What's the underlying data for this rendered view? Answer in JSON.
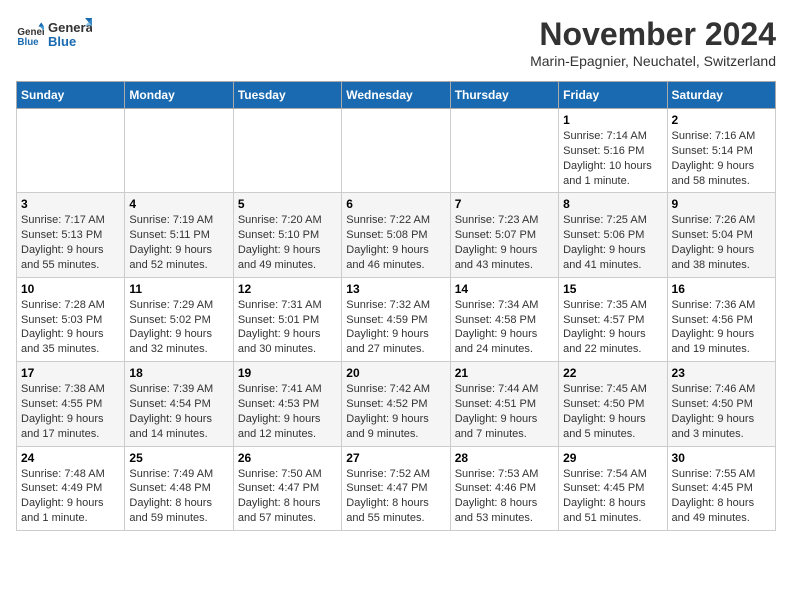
{
  "logo": {
    "line1": "General",
    "line2": "Blue"
  },
  "title": "November 2024",
  "location": "Marin-Epagnier, Neuchatel, Switzerland",
  "days_of_week": [
    "Sunday",
    "Monday",
    "Tuesday",
    "Wednesday",
    "Thursday",
    "Friday",
    "Saturday"
  ],
  "weeks": [
    [
      {
        "day": "",
        "info": ""
      },
      {
        "day": "",
        "info": ""
      },
      {
        "day": "",
        "info": ""
      },
      {
        "day": "",
        "info": ""
      },
      {
        "day": "",
        "info": ""
      },
      {
        "day": "1",
        "info": "Sunrise: 7:14 AM\nSunset: 5:16 PM\nDaylight: 10 hours and 1 minute."
      },
      {
        "day": "2",
        "info": "Sunrise: 7:16 AM\nSunset: 5:14 PM\nDaylight: 9 hours and 58 minutes."
      }
    ],
    [
      {
        "day": "3",
        "info": "Sunrise: 7:17 AM\nSunset: 5:13 PM\nDaylight: 9 hours and 55 minutes."
      },
      {
        "day": "4",
        "info": "Sunrise: 7:19 AM\nSunset: 5:11 PM\nDaylight: 9 hours and 52 minutes."
      },
      {
        "day": "5",
        "info": "Sunrise: 7:20 AM\nSunset: 5:10 PM\nDaylight: 9 hours and 49 minutes."
      },
      {
        "day": "6",
        "info": "Sunrise: 7:22 AM\nSunset: 5:08 PM\nDaylight: 9 hours and 46 minutes."
      },
      {
        "day": "7",
        "info": "Sunrise: 7:23 AM\nSunset: 5:07 PM\nDaylight: 9 hours and 43 minutes."
      },
      {
        "day": "8",
        "info": "Sunrise: 7:25 AM\nSunset: 5:06 PM\nDaylight: 9 hours and 41 minutes."
      },
      {
        "day": "9",
        "info": "Sunrise: 7:26 AM\nSunset: 5:04 PM\nDaylight: 9 hours and 38 minutes."
      }
    ],
    [
      {
        "day": "10",
        "info": "Sunrise: 7:28 AM\nSunset: 5:03 PM\nDaylight: 9 hours and 35 minutes."
      },
      {
        "day": "11",
        "info": "Sunrise: 7:29 AM\nSunset: 5:02 PM\nDaylight: 9 hours and 32 minutes."
      },
      {
        "day": "12",
        "info": "Sunrise: 7:31 AM\nSunset: 5:01 PM\nDaylight: 9 hours and 30 minutes."
      },
      {
        "day": "13",
        "info": "Sunrise: 7:32 AM\nSunset: 4:59 PM\nDaylight: 9 hours and 27 minutes."
      },
      {
        "day": "14",
        "info": "Sunrise: 7:34 AM\nSunset: 4:58 PM\nDaylight: 9 hours and 24 minutes."
      },
      {
        "day": "15",
        "info": "Sunrise: 7:35 AM\nSunset: 4:57 PM\nDaylight: 9 hours and 22 minutes."
      },
      {
        "day": "16",
        "info": "Sunrise: 7:36 AM\nSunset: 4:56 PM\nDaylight: 9 hours and 19 minutes."
      }
    ],
    [
      {
        "day": "17",
        "info": "Sunrise: 7:38 AM\nSunset: 4:55 PM\nDaylight: 9 hours and 17 minutes."
      },
      {
        "day": "18",
        "info": "Sunrise: 7:39 AM\nSunset: 4:54 PM\nDaylight: 9 hours and 14 minutes."
      },
      {
        "day": "19",
        "info": "Sunrise: 7:41 AM\nSunset: 4:53 PM\nDaylight: 9 hours and 12 minutes."
      },
      {
        "day": "20",
        "info": "Sunrise: 7:42 AM\nSunset: 4:52 PM\nDaylight: 9 hours and 9 minutes."
      },
      {
        "day": "21",
        "info": "Sunrise: 7:44 AM\nSunset: 4:51 PM\nDaylight: 9 hours and 7 minutes."
      },
      {
        "day": "22",
        "info": "Sunrise: 7:45 AM\nSunset: 4:50 PM\nDaylight: 9 hours and 5 minutes."
      },
      {
        "day": "23",
        "info": "Sunrise: 7:46 AM\nSunset: 4:50 PM\nDaylight: 9 hours and 3 minutes."
      }
    ],
    [
      {
        "day": "24",
        "info": "Sunrise: 7:48 AM\nSunset: 4:49 PM\nDaylight: 9 hours and 1 minute."
      },
      {
        "day": "25",
        "info": "Sunrise: 7:49 AM\nSunset: 4:48 PM\nDaylight: 8 hours and 59 minutes."
      },
      {
        "day": "26",
        "info": "Sunrise: 7:50 AM\nSunset: 4:47 PM\nDaylight: 8 hours and 57 minutes."
      },
      {
        "day": "27",
        "info": "Sunrise: 7:52 AM\nSunset: 4:47 PM\nDaylight: 8 hours and 55 minutes."
      },
      {
        "day": "28",
        "info": "Sunrise: 7:53 AM\nSunset: 4:46 PM\nDaylight: 8 hours and 53 minutes."
      },
      {
        "day": "29",
        "info": "Sunrise: 7:54 AM\nSunset: 4:45 PM\nDaylight: 8 hours and 51 minutes."
      },
      {
        "day": "30",
        "info": "Sunrise: 7:55 AM\nSunset: 4:45 PM\nDaylight: 8 hours and 49 minutes."
      }
    ]
  ]
}
